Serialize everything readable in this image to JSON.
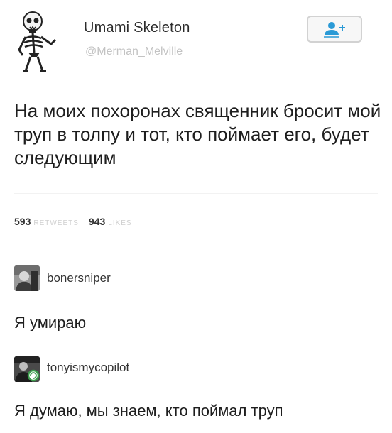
{
  "tweet": {
    "author_name": "Umami Skeleton",
    "author_handle": "@Merman_Melville",
    "text": "На моих похоронах священник бросит мой труп в толпу и тот, кто поймает его, будет следующим",
    "retweets_count": "593",
    "retweets_label": "RETWEETS",
    "likes_count": "943",
    "likes_label": "LIKES"
  },
  "comments": [
    {
      "username": "bonersniper",
      "text": "Я умираю",
      "avatar_icon": "person-portrait-icon"
    },
    {
      "username": "tonyismycopilot",
      "text": "Я думаю, мы знаем, кто поймал труп",
      "avatar_icon": "person-portrait-icon"
    }
  ],
  "icons": {
    "author_avatar": "skeleton-icon",
    "follow": "add-user-icon"
  },
  "colors": {
    "handle": "#c3c3c3",
    "follow_border": "#d2d2d2",
    "follow_icon": "#2a9ad6",
    "stat_label": "#d0d0d0"
  }
}
